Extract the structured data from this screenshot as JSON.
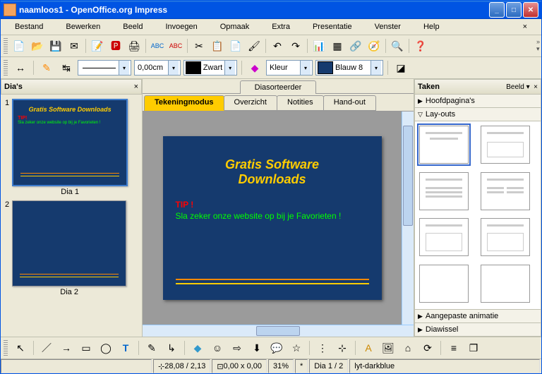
{
  "title": "naamloos1 - OpenOffice.org Impress",
  "menus": [
    "Bestand",
    "Bewerken",
    "Beeld",
    "Invoegen",
    "Opmaak",
    "Extra",
    "Presentatie",
    "Venster",
    "Help"
  ],
  "toolbar2": {
    "lineWidth": "0,00cm",
    "lineColorName": "Zwart",
    "lineColorHex": "#000000",
    "fillType": "Kleur",
    "fillName": "Blauw 8",
    "fillHex": "#153a6e"
  },
  "leftPanel": {
    "title": "Dia's",
    "slides": [
      {
        "num": "1",
        "label": "Dia 1",
        "title": "Gratis Software Downloads",
        "tip": "TIP!",
        "body": "Sla zeker onze website op bij je Favorieten !"
      },
      {
        "num": "2",
        "label": "Dia 2",
        "title": "",
        "tip": "",
        "body": ""
      }
    ]
  },
  "centerTabs": {
    "top": "Diasorteerder",
    "sub": [
      "Tekeningmodus",
      "Overzicht",
      "Notities",
      "Hand-out"
    ],
    "activeIndex": 0
  },
  "slideContent": {
    "titleLine1": "Gratis Software",
    "titleLine2": "Downloads",
    "tip": "TIP !",
    "body": "Sla zeker onze website op bij je Favorieten !"
  },
  "tasks": {
    "title": "Taken",
    "viewLabel": "Beeld",
    "sections": {
      "masterPages": "Hoofdpagina's",
      "layouts": "Lay-outs",
      "customAnim": "Aangepaste animatie",
      "slideTrans": "Diawissel"
    }
  },
  "status": {
    "pos": "28,08 / 2,13",
    "size": "0,00 x 0,00",
    "zoom": "31%",
    "mark": "*",
    "slide": "Dia 1 / 2",
    "template": "lyt-darkblue"
  },
  "icons": {
    "dropdown": "▾",
    "close": "×",
    "right": "▶",
    "down": "▽",
    "min": "_",
    "max": "□",
    "x": "✕",
    "smile": "☺"
  }
}
